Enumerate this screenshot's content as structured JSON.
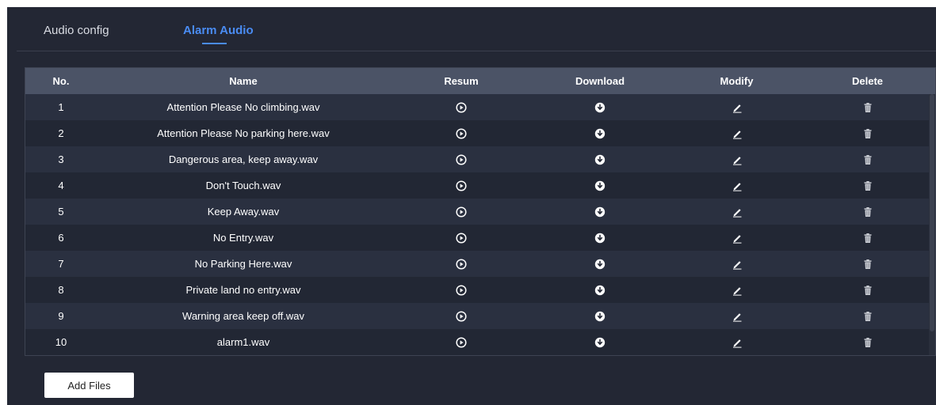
{
  "tabs": [
    {
      "label": "Audio config",
      "active": false
    },
    {
      "label": "Alarm Audio",
      "active": true
    }
  ],
  "table": {
    "headers": [
      "No.",
      "Name",
      "Resum",
      "Download",
      "Modify",
      "Delete"
    ],
    "row_icons": {
      "resum": "play-circle-icon",
      "download": "download-circle-icon",
      "modify": "pencil-icon",
      "delete": "trash-icon"
    },
    "rows": [
      {
        "no": "1",
        "name": "Attention Please No climbing.wav"
      },
      {
        "no": "2",
        "name": "Attention Please No parking here.wav"
      },
      {
        "no": "3",
        "name": "Dangerous area, keep away.wav"
      },
      {
        "no": "4",
        "name": "Don't Touch.wav"
      },
      {
        "no": "5",
        "name": "Keep Away.wav"
      },
      {
        "no": "6",
        "name": "No Entry.wav"
      },
      {
        "no": "7",
        "name": "No Parking Here.wav"
      },
      {
        "no": "8",
        "name": "Private land no entry.wav"
      },
      {
        "no": "9",
        "name": "Warning area keep off.wav"
      },
      {
        "no": "10",
        "name": "alarm1.wav"
      }
    ]
  },
  "add_button_label": "Add Files",
  "colors": {
    "background": "#232734",
    "header_bg": "#4b5366",
    "accent": "#4a8cf3",
    "row_odd": "#2a3040",
    "row_even": "#222734"
  }
}
